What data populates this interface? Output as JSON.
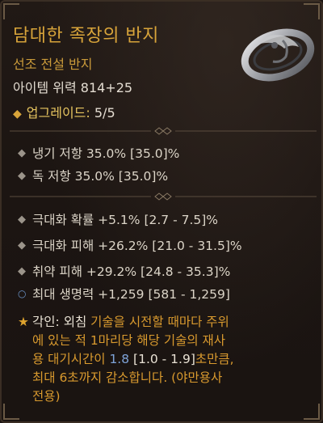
{
  "item": {
    "name": "담대한 족장의 반지",
    "type": "선조 전설 반지",
    "power": "아이템 위력 814+25",
    "upgrade_label": "업그레이드:",
    "upgrade_value": "5/5"
  },
  "stats_group1": [
    {
      "text": "냉기 저항 35.0% [35.0]%"
    },
    {
      "text": "독 저항 35.0% [35.0]%"
    }
  ],
  "stats_group2": [
    {
      "text": "극대화 확률 +5.1% [2.7 - 7.5]%"
    },
    {
      "text": "극대화 피해 +26.2% [21.0 - 31.5]%"
    },
    {
      "text": "취약 피해 +29.2% [24.8 - 35.3]%"
    },
    {
      "text": "최대 생명력 +1,259 [581 - 1,259]"
    }
  ],
  "aspect": {
    "label": "각인:",
    "skill": "외침",
    "text1": "기술을 시전할 때마다 주위",
    "line2": "에 있는 적 1마리당 해당 기술의 재사",
    "line3a": "용 대기시간이",
    "value": "1.8",
    "range": "[1.0 - 1.9]",
    "line3b": "초만큼,",
    "line4": "최대 6초까지 감소합니다. (야만용사",
    "line5": "전용)"
  },
  "colors": {
    "title": "#d8a43a",
    "item_type": "#c99a3a",
    "aspect_orange": "#d99a2e",
    "aspect_value_blue": "#7ea3d8",
    "background": "#1c1512"
  }
}
